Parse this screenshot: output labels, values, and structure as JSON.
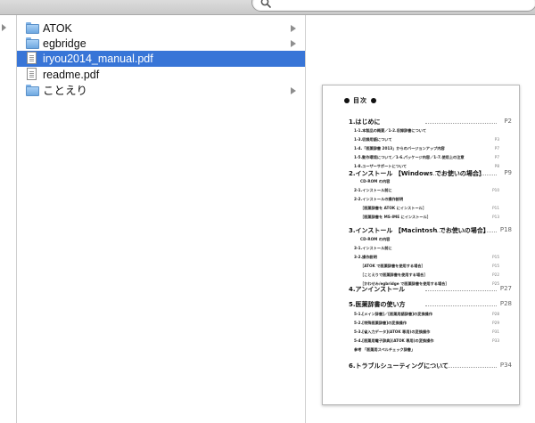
{
  "toolbar": {
    "search_placeholder": ""
  },
  "files": [
    {
      "name": "ATOK",
      "kind": "folder",
      "has_children": true,
      "selected": false
    },
    {
      "name": "egbridge",
      "kind": "folder",
      "has_children": true,
      "selected": false
    },
    {
      "name": "iryou2014_manual.pdf",
      "kind": "document",
      "has_children": false,
      "selected": true
    },
    {
      "name": "readme.pdf",
      "kind": "document",
      "has_children": false,
      "selected": false
    },
    {
      "name": "ことえり",
      "kind": "folder",
      "has_children": true,
      "selected": false
    }
  ],
  "preview": {
    "title": "目次",
    "sections": [
      {
        "label": "1.はじめに",
        "page": "P2"
      },
      {
        "label": "2.インストール 【Windows でお使いの場合】",
        "page": "P9"
      },
      {
        "label": "3.インストール 【Macintosh でお使いの場合】",
        "page": "P18"
      },
      {
        "label": "4.アンインストール",
        "page": "P27"
      },
      {
        "label": "5.医薬辞書の使い方",
        "page": "P28"
      },
      {
        "label": "6.トラブルシューティングについて",
        "page": "P34"
      }
    ],
    "subsections": [
      [
        "1-1.本製品の概要／1-2.収録辞書について",
        "1-3.収録用語について",
        "1-4.「医薬辞書 2013」からのバージョンアップ内容",
        "1-5.動作環境について／1-6.パッケージ内容／1-7.使用上の注意",
        "1-8.ユーザーサポートについて"
      ],
      [
        "CD-ROM の内容",
        "2-1.インストール前に",
        "2-2.インストールの操作説明",
        "［医薬辞書を ATOK にインストール］",
        "［医薬辞書を MS-IME にインストール］"
      ],
      [
        "CD-ROM の内容",
        "3-1.インストール前に",
        "3-2.操作説明",
        "［ATOK で医薬辞書を使用する場合］",
        "［ことえりで医薬辞書を使用する場合］",
        "［かわせみ/egbridge で医薬辞書を使用する場合］"
      ],
      [],
      [
        "5-1.[メイン辞書]／[医薬用語辞書]の変換操作",
        "5-2.[特殊医薬辞書]の変換操作",
        "5-3.[省入力データ](ATOK 専用)の変換操作",
        "5-4.[医薬用電子辞典](ATOK 専用)の変換操作",
        "参考 「医薬用スペルチェック辞書」"
      ],
      []
    ],
    "subsection_pages": [
      [
        "",
        "P3",
        "P7",
        "P7",
        "P8"
      ],
      [
        "",
        "P10",
        "",
        "P11",
        "P13"
      ],
      [
        "",
        "",
        "P15",
        "P15",
        "P22",
        "P25"
      ],
      [],
      [
        "P28",
        "P29",
        "P31",
        "P33",
        ""
      ],
      []
    ]
  }
}
